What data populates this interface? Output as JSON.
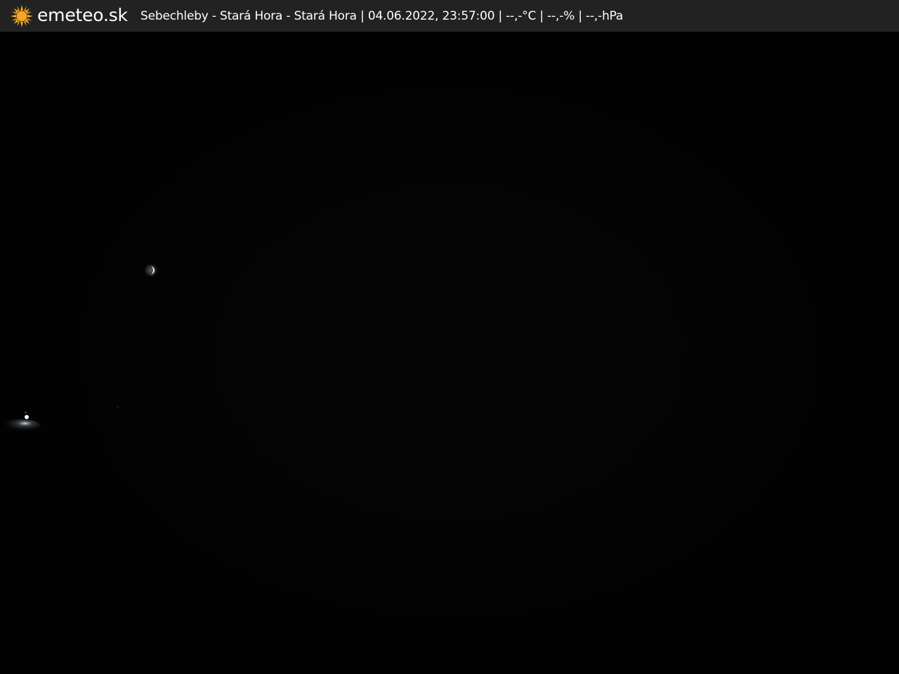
{
  "header": {
    "brand": "emeteo.sk",
    "status_line": "Sebechleby - Stará Hora - Stará Hora | 04.06.2022, 23:57:00 | --,-°C | --,-% | --,-hPa",
    "logo_icon": "sun-icon",
    "logo_color": "#f5a623"
  },
  "image": {
    "moon_icon": "moon-icon",
    "background_color": "#030303"
  }
}
